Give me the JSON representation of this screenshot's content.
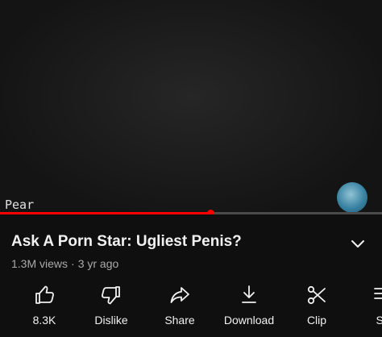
{
  "video": {
    "overlay_text": "Pear",
    "progress": 0.55
  },
  "info": {
    "title": "Ask A Porn Star: Ugliest Penis?",
    "views": "1.3M views",
    "age": "3 yr ago",
    "separator": "·"
  },
  "actions": [
    {
      "name": "like-button",
      "icon": "thumb-up-icon",
      "label": "8.3K"
    },
    {
      "name": "dislike-button",
      "icon": "thumb-down-icon",
      "label": "Dislike"
    },
    {
      "name": "share-button",
      "icon": "share-arrow-icon",
      "label": "Share"
    },
    {
      "name": "download-button",
      "icon": "download-icon",
      "label": "Download"
    },
    {
      "name": "clip-button",
      "icon": "scissors-icon",
      "label": "Clip"
    },
    {
      "name": "save-button",
      "icon": "save-icon",
      "label": "Sa"
    }
  ],
  "colors": {
    "background": "#0f0f0f",
    "progress": "#ff0000",
    "secondary_text": "#aaaaaa"
  }
}
